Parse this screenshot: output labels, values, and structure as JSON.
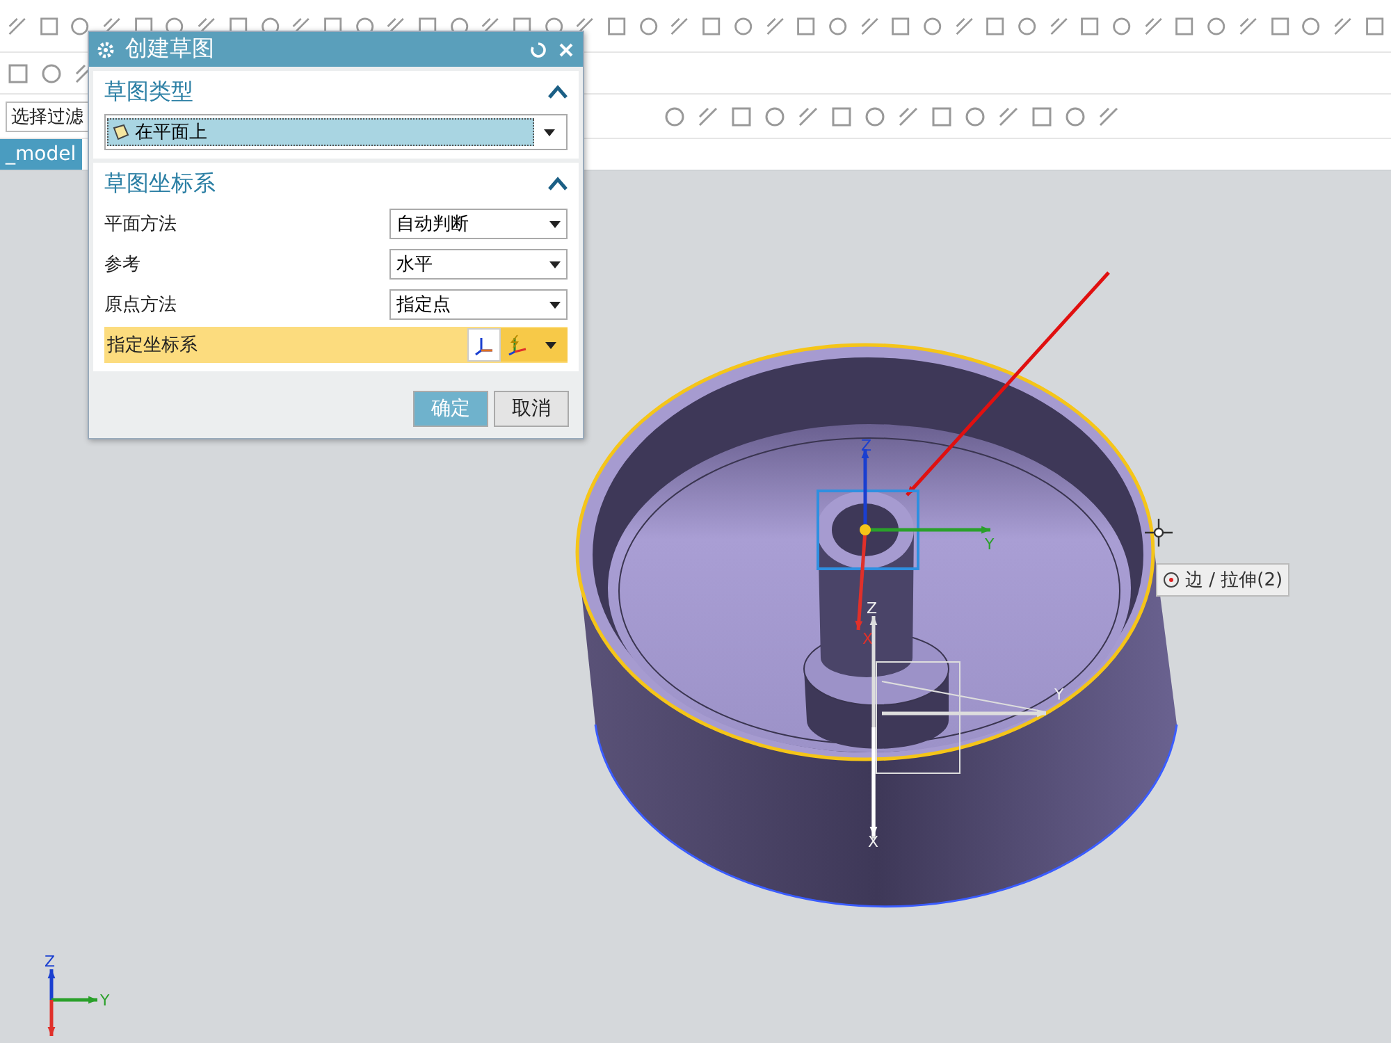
{
  "toolbar": {
    "filter_label": "选择过滤"
  },
  "tab": {
    "label": "_model",
    "selected": true
  },
  "dialog": {
    "title": "创建草图",
    "sections": [
      {
        "title": "草图类型",
        "expanded": true,
        "rows": [
          {
            "kind": "type_select",
            "value": "在平面上"
          }
        ]
      },
      {
        "title": "草图坐标系",
        "expanded": true,
        "rows": [
          {
            "kind": "select",
            "label": "平面方法",
            "value": "自动判断"
          },
          {
            "kind": "select",
            "label": "参考",
            "value": "水平"
          },
          {
            "kind": "select",
            "label": "原点方法",
            "value": "指定点"
          },
          {
            "kind": "csys",
            "label": "指定坐标系",
            "highlighted": true
          }
        ]
      }
    ],
    "buttons": [
      {
        "label": "确定",
        "kind": "primary"
      },
      {
        "label": "取消",
        "kind": "secondary"
      }
    ]
  },
  "viewport": {
    "tooltip": "边 / 拉伸(2)",
    "triads": [
      {
        "kind": "sketch",
        "z": "Z",
        "y": "Y",
        "x": "X"
      },
      {
        "kind": "datum",
        "z": "Z",
        "y": "Y",
        "x": "X"
      },
      {
        "kind": "view",
        "z": "Z",
        "y": "Y"
      }
    ]
  }
}
